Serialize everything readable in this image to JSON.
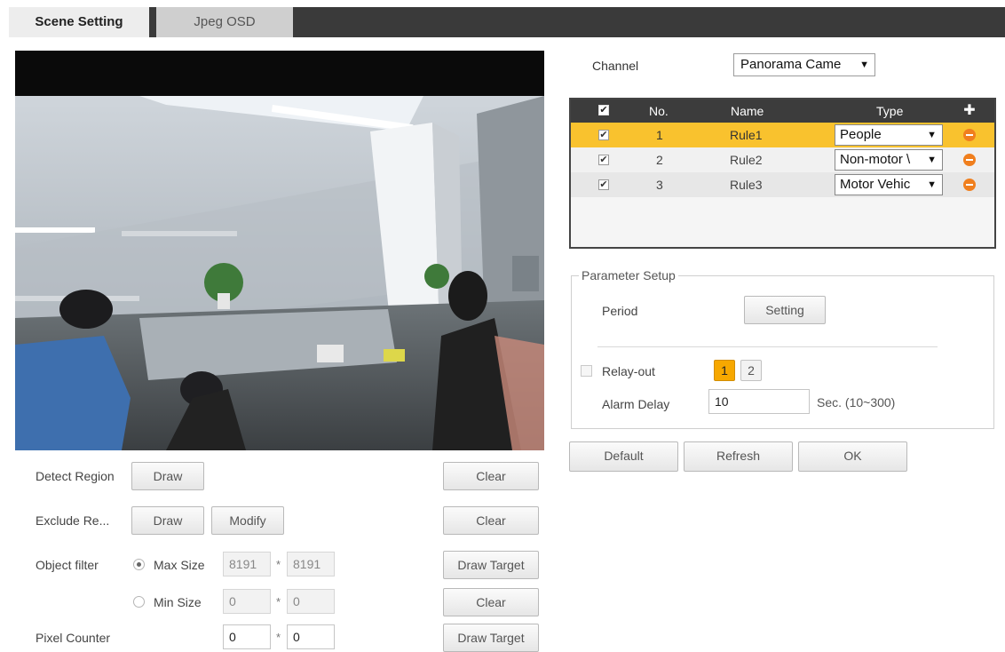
{
  "tabs": {
    "scene_setting": "Scene Setting",
    "jpeg_osd": "Jpeg OSD"
  },
  "left": {
    "detect_region_label": "Detect Region",
    "detect_draw": "Draw",
    "detect_clear": "Clear",
    "exclude_label": "Exclude Re...",
    "exclude_draw": "Draw",
    "exclude_modify": "Modify",
    "exclude_clear": "Clear",
    "object_filter_label": "Object filter",
    "max_size_label": "Max Size",
    "max_w": "8191",
    "max_h": "8191",
    "draw_target_1": "Draw Target",
    "min_size_label": "Min Size",
    "min_w": "0",
    "min_h": "0",
    "min_clear": "Clear",
    "pixel_counter_label": "Pixel Counter",
    "pix_w": "0",
    "pix_h": "0",
    "draw_target_2": "Draw Target",
    "times": "*"
  },
  "right": {
    "channel_label": "Channel",
    "channel_value": "Panorama Came",
    "table_headers": {
      "no": "No.",
      "name": "Name",
      "type": "Type"
    },
    "rules": [
      {
        "no": "1",
        "name": "Rule1",
        "type": "People"
      },
      {
        "no": "2",
        "name": "Rule2",
        "type": "Non-motor \\"
      },
      {
        "no": "3",
        "name": "Rule3",
        "type": "Motor Vehic"
      }
    ],
    "parameter_setup": "Parameter Setup",
    "period_label": "Period",
    "setting_button": "Setting",
    "relay_out_label": "Relay-out",
    "relay_1": "1",
    "relay_2": "2",
    "alarm_delay_label": "Alarm Delay",
    "alarm_delay_value": "10",
    "alarm_delay_range": "Sec. (10~300)",
    "default_button": "Default",
    "refresh_button": "Refresh",
    "ok_button": "OK"
  },
  "icons": {
    "checkmark": "✔",
    "dropdown": "▼",
    "add": "✚"
  },
  "colors": {
    "selected_row": "#f9c22e",
    "relay_active": "#f7a800",
    "remove_icon": "#f07f1e",
    "header_dark": "#3c3c3c"
  }
}
